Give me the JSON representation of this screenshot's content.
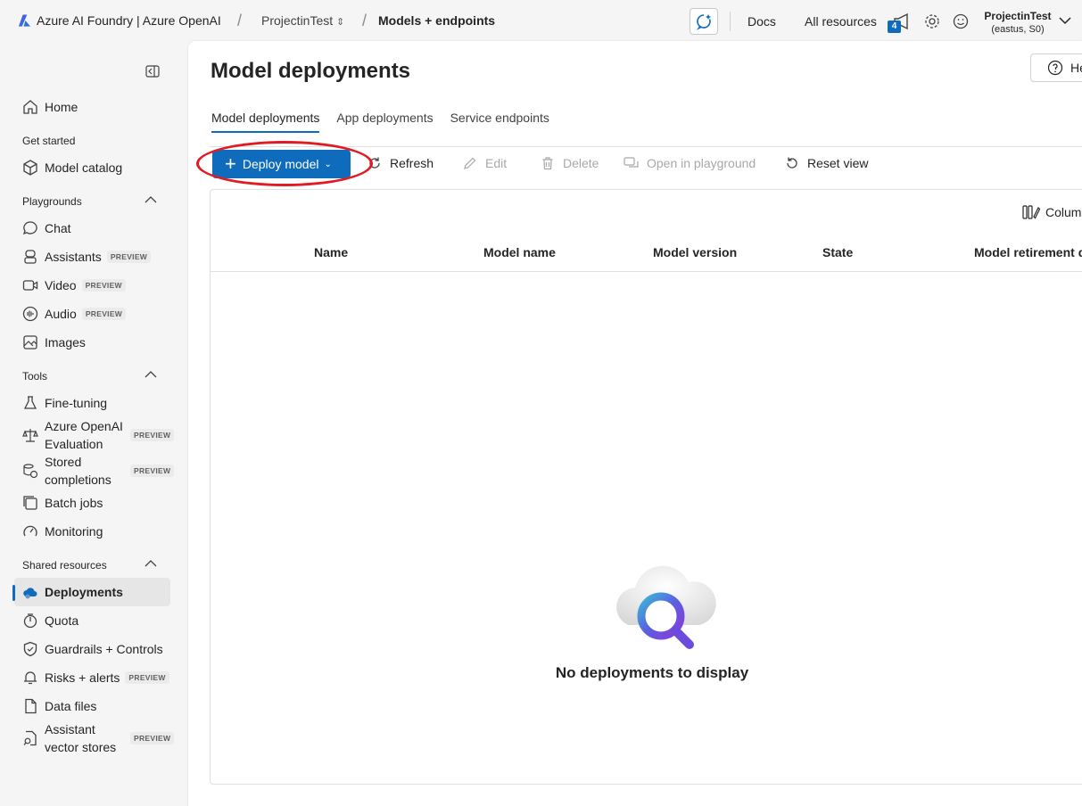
{
  "topbar": {
    "app_title": "Azure AI Foundry | Azure OpenAI",
    "breadcrumb_project": "ProjectinTest",
    "breadcrumb_page": "Models + endpoints",
    "docs": "Docs",
    "all_resources": "All resources",
    "notification_count": "4",
    "account_name": "ProjectinTest",
    "account_region": "(eastus, S0)",
    "accent_color": "#0f6cbd"
  },
  "sidebar": {
    "home": "Home",
    "get_started": "Get started",
    "model_catalog": "Model catalog",
    "playgrounds": "Playgrounds",
    "chat": "Chat",
    "assistants": "Assistants",
    "video": "Video",
    "audio": "Audio",
    "images": "Images",
    "tools": "Tools",
    "fine_tuning": "Fine-tuning",
    "aoai_evaluation": "Azure OpenAI Evaluation",
    "stored_completions": "Stored completions",
    "batch_jobs": "Batch jobs",
    "monitoring": "Monitoring",
    "shared_resources": "Shared resources",
    "deployments": "Deployments",
    "quota": "Quota",
    "guardrails": "Guardrails + Controls",
    "risks_alerts": "Risks + alerts",
    "data_files": "Data files",
    "assistant_vector_stores": "Assistant vector stores",
    "preview_tag": "PREVIEW"
  },
  "main": {
    "title": "Model deployments",
    "help": "He",
    "tabs": [
      "Model deployments",
      "App deployments",
      "Service endpoints"
    ],
    "toolbar": {
      "deploy_model": "Deploy model",
      "refresh": "Refresh",
      "edit": "Edit",
      "delete": "Delete",
      "open_in_playground": "Open in playground",
      "reset_view": "Reset view"
    },
    "columns_button": "Colum",
    "table_headers": [
      "Name",
      "Model name",
      "Model version",
      "State",
      "Model retirement d"
    ],
    "empty_message": "No deployments to display"
  }
}
